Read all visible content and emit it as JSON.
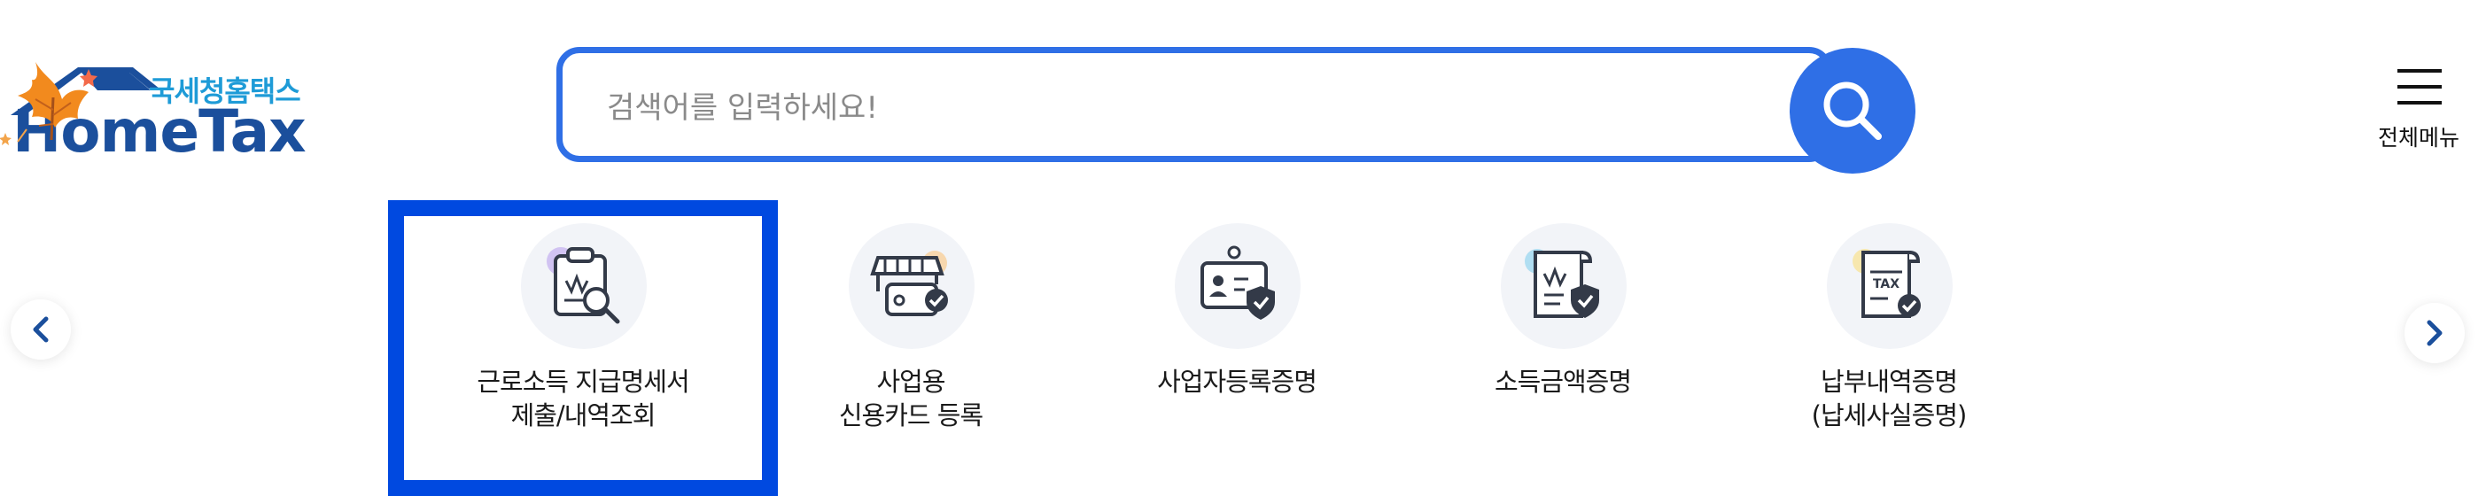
{
  "logo": {
    "subtitle": "국세청홈택스",
    "title": "HomeTax"
  },
  "search": {
    "placeholder": "검색어를 입력하세요!",
    "value": ""
  },
  "menu": {
    "label": "전체메뉴"
  },
  "colors": {
    "accent": "#2f6fe6",
    "logo_blue": "#1b4f9c",
    "logo_cyan": "#1e9bd7",
    "highlight": "#0049e0"
  },
  "services": [
    {
      "icon": "clipboard-search-icon",
      "line1": "근로소득 지급명세서",
      "line2": "제출/내역조회"
    },
    {
      "icon": "store-card-icon",
      "line1": "사업용",
      "line2": "신용카드 등록"
    },
    {
      "icon": "id-card-shield-icon",
      "line1": "사업자등록증명",
      "line2": ""
    },
    {
      "icon": "document-shield-icon",
      "line1": "소득금액증명",
      "line2": ""
    },
    {
      "icon": "tax-document-icon",
      "line1": "납부내역증명",
      "line2": "(납세사실증명)"
    }
  ]
}
